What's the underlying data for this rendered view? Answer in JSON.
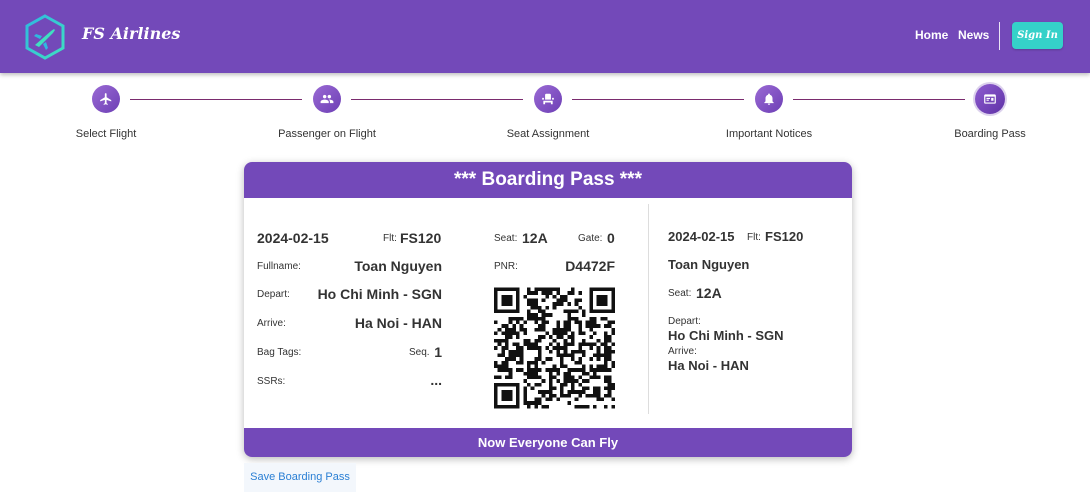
{
  "header": {
    "brand": "FS Airlines",
    "nav": {
      "home": "Home",
      "news": "News"
    },
    "signin": "Sign In",
    "colors": {
      "primary": "#7349b9",
      "accent": "#35d1c9"
    }
  },
  "stepper": {
    "steps": [
      {
        "label": "Select Flight",
        "icon": "airplane-icon"
      },
      {
        "label": "Passenger on Flight",
        "icon": "people-icon"
      },
      {
        "label": "Seat Assignment",
        "icon": "seat-icon"
      },
      {
        "label": "Important Notices",
        "icon": "bell-icon"
      },
      {
        "label": "Boarding Pass",
        "icon": "ticket-icon"
      }
    ],
    "active_step": "Boarding Pass"
  },
  "boarding_pass": {
    "title": "*** Boarding Pass ***",
    "footer": "Now Everyone Can Fly",
    "main": {
      "date": "2024-02-15",
      "flt_label": "Flt:",
      "flt": "FS120",
      "fullname_label": "Fullname:",
      "fullname": "Toan Nguyen",
      "depart_label": "Depart:",
      "depart": "Ho Chi Minh - SGN",
      "arrive_label": "Arrive:",
      "arrive": "Ha Noi - HAN",
      "bagtags_label": "Bag Tags:",
      "seq_label": "Seq.",
      "seq": "1",
      "ssrs_label": "SSRs:",
      "ssrs": "..."
    },
    "middle": {
      "seat_label": "Seat:",
      "seat": "12A",
      "gate_label": "Gate:",
      "gate": "0",
      "pnr_label": "PNR:",
      "pnr": "D4472F"
    },
    "stub": {
      "date": "2024-02-15",
      "flt_label": "Flt:",
      "flt": "FS120",
      "name": "Toan Nguyen",
      "seat_label": "Seat:",
      "seat": "12A",
      "depart_label": "Depart:",
      "depart": "Ho Chi Minh - SGN",
      "arrive_label": "Arrive:",
      "arrive": "Ha Noi - HAN"
    }
  },
  "actions": {
    "save": "Save Boarding Pass"
  }
}
